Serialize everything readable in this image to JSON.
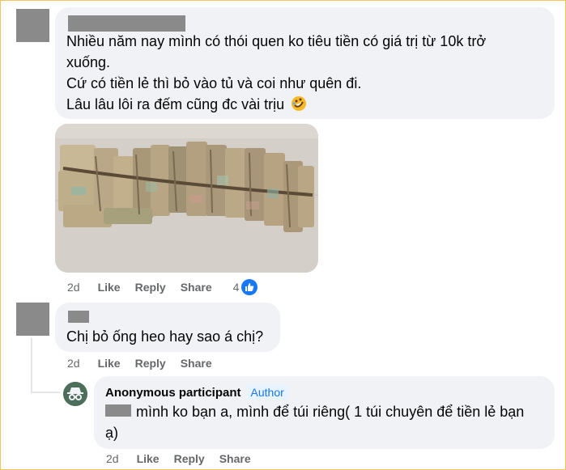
{
  "comment1": {
    "lines": [
      "Nhiều năm nay mình có thói quen ko tiêu tiền có giá trị từ 10k trở",
      "xuống.",
      "Cứ có tiền lẻ thì bỏ vào tủ và coi như quên đi.",
      "Lâu lâu lôi ra đếm cũng đc vài trịu"
    ],
    "emoji": "rolling-on-floor-laughing-icon",
    "time": "2d",
    "like": "Like",
    "reply": "Reply",
    "share": "Share",
    "reaction_count": "4"
  },
  "comment2": {
    "text": "Chị bỏ ống heo hay sao á chị?",
    "time": "2d",
    "like": "Like",
    "reply": "Reply",
    "share": "Share"
  },
  "comment3": {
    "author": "Anonymous participant",
    "badge": "Author",
    "line1": "mình ko bạn a, mình để túi riêng( 1 túi chuyên để tiền lẻ bạn",
    "line2": "ạ)",
    "time": "2d",
    "like": "Like",
    "reply": "Reply",
    "share": "Share"
  },
  "colors": {
    "accent": "#1877f2",
    "bubble": "#f0f2f5",
    "meta": "#65676b",
    "redaction": "#8a8a8a",
    "frame": "#f2c25b"
  }
}
